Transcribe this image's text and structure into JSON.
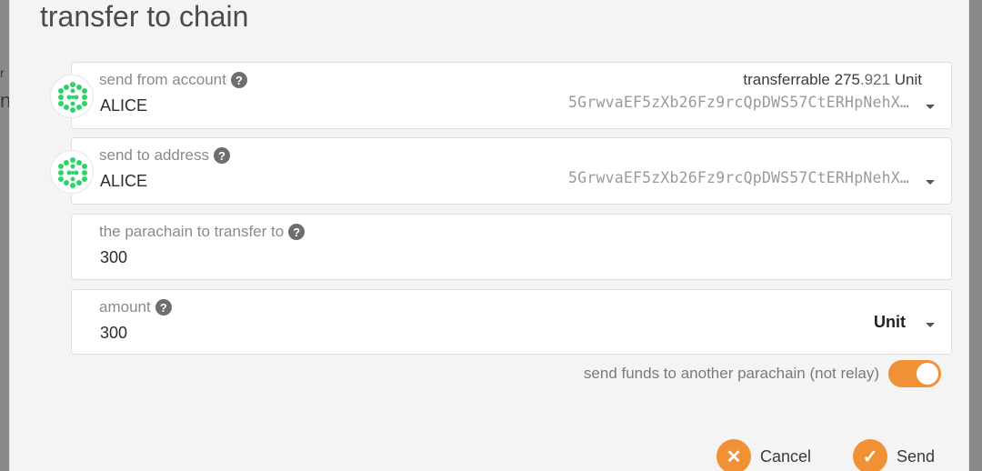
{
  "dialog": {
    "title": "transfer to chain"
  },
  "background": {
    "left_fragment": "n",
    "left_fragment_top": "r"
  },
  "send_from": {
    "label": "send from account",
    "account_name": "ALICE",
    "address": "5GrwvaEF5zXb26Fz9rcQpDWS57CtERHpNehX…",
    "transferrable_label": "transferrable",
    "transferrable_int": "275",
    "transferrable_dec": ".921",
    "transferrable_unit": "Unit"
  },
  "send_to": {
    "label": "send to address",
    "account_name": "ALICE",
    "address": "5GrwvaEF5zXb26Fz9rcQpDWS57CtERHpNehX…"
  },
  "parachain": {
    "label": "the parachain to transfer to",
    "value": "300"
  },
  "amount": {
    "label": "amount",
    "value": "300",
    "unit": "Unit"
  },
  "toggle": {
    "label": "send funds to another parachain (not relay)",
    "state": "on"
  },
  "actions": {
    "cancel_label": "Cancel",
    "send_label": "Send"
  },
  "colors": {
    "accent": "#f19135",
    "identicon_green": "#2fd36a"
  }
}
